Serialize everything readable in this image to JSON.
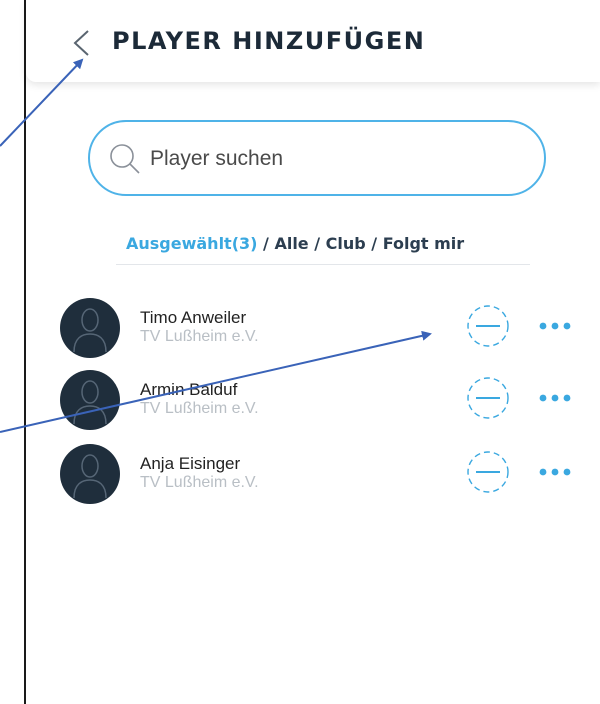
{
  "header": {
    "title": "PLAYER HINZUFÜGEN"
  },
  "search": {
    "placeholder": "Player suchen"
  },
  "filters": {
    "selected": "Ausgewählt(3)",
    "all": "Alle",
    "club": "Club",
    "follows_me": "Folgt mir",
    "separator": " / "
  },
  "players": [
    {
      "name": "Timo Anweiler",
      "club": "TV Lußheim e.V."
    },
    {
      "name": "Armin Balduf",
      "club": "TV Lußheim e.V."
    },
    {
      "name": "Anja Eisinger",
      "club": "TV Lußheim e.V."
    }
  ],
  "colors": {
    "accent": "#3aa8e0",
    "dark": "#1f2e3c",
    "annotation_arrow": "#3a63b8"
  },
  "icons": {
    "back": "chevron-left-icon",
    "search": "search-icon",
    "avatar": "user-silhouette-icon",
    "remove": "minus-circle-dashed-icon",
    "more": "more-dots-icon"
  }
}
